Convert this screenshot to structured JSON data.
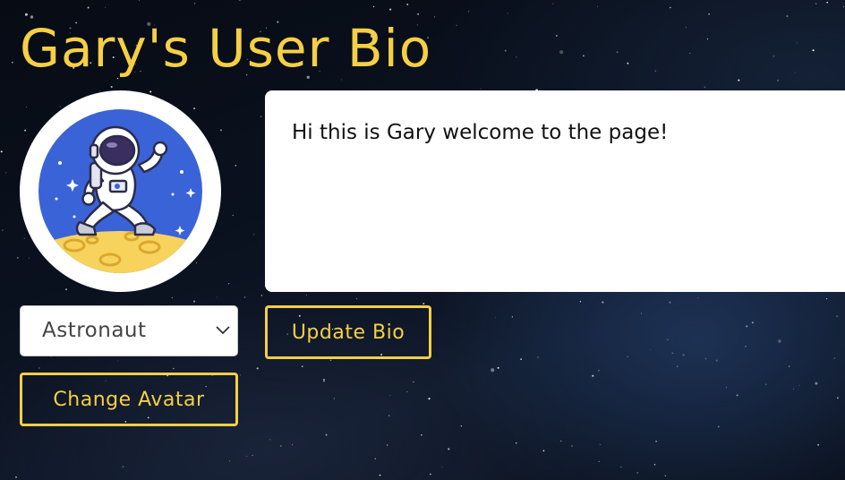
{
  "page": {
    "title": "Gary's User Bio"
  },
  "theme": {
    "accent": "#f5cf45",
    "background": "#0b1220",
    "panel": "#ffffff"
  },
  "avatar": {
    "icon": "astronaut-avatar-icon"
  },
  "bio": {
    "text": "Hi this is Gary welcome to the page!"
  },
  "avatar_select": {
    "selected": "Astronaut",
    "icon": "chevron-down-icon"
  },
  "buttons": {
    "update_bio": "Update Bio",
    "change_avatar": "Change Avatar"
  }
}
